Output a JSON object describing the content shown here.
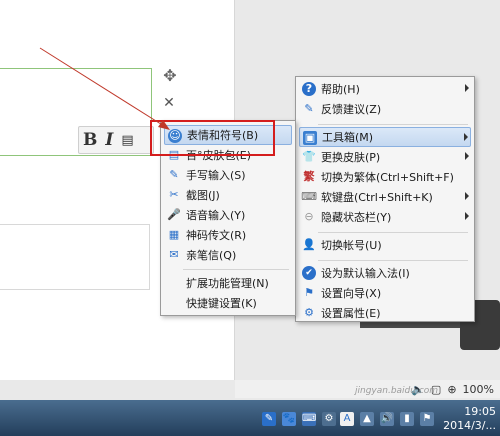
{
  "format_bar": {
    "bold": "B",
    "italic": "I"
  },
  "main_menu": {
    "items": [
      {
        "label": "帮助(H)",
        "icon": "help-icon",
        "submenu": true
      },
      {
        "label": "反馈建议(Z)",
        "icon": "feedback-icon",
        "submenu": false
      },
      {
        "label": "工具箱(M)",
        "icon": "toolbox-icon",
        "submenu": true,
        "highlighted": true
      },
      {
        "label": "更换皮肤(P)",
        "icon": "skin-icon",
        "submenu": true
      },
      {
        "label": "切换为繁体(Ctrl+Shift+F)",
        "icon": "traditional-icon",
        "submenu": false
      },
      {
        "label": "软键盘(Ctrl+Shift+K)",
        "icon": "keyboard-icon",
        "submenu": true
      },
      {
        "label": "隐藏状态栏(Y)",
        "icon": "hide-statusbar-icon",
        "submenu": true
      },
      {
        "label": "切换帐号(U)",
        "icon": "account-icon",
        "submenu": false
      },
      {
        "label": "设为默认输入法(I)",
        "icon": "default-ime-icon",
        "submenu": false
      },
      {
        "label": "设置向导(X)",
        "icon": "wizard-icon",
        "submenu": false
      },
      {
        "label": "设置属性(E)",
        "icon": "settings-icon",
        "submenu": false
      }
    ]
  },
  "toolbox_menu": {
    "items": [
      {
        "label": "表情和符号(B)",
        "icon": "emoji-icon",
        "highlighted": true
      },
      {
        "label": "百°皮肤包(E)",
        "icon": "skin-pack-icon"
      },
      {
        "label": "手写输入(S)",
        "icon": "handwriting-icon"
      },
      {
        "label": "截图(J)",
        "icon": "screenshot-icon"
      },
      {
        "label": "语音输入(Y)",
        "icon": "voice-input-icon"
      },
      {
        "label": "神码传文(R)",
        "icon": "qrcode-icon"
      },
      {
        "label": "亲笔信(Q)",
        "icon": "letter-icon"
      },
      {
        "label": "扩展功能管理(N)",
        "icon": ""
      },
      {
        "label": "快捷键设置(K)",
        "icon": ""
      }
    ]
  },
  "statusbar": {
    "zoom": "100%"
  },
  "taskbar": {
    "time": "19:05",
    "date": "2014/3/..."
  },
  "watermark": "jingyan.baidu.com",
  "colors": {
    "highlight_box": "#d41d1d",
    "accent": "#2a6fc9"
  }
}
